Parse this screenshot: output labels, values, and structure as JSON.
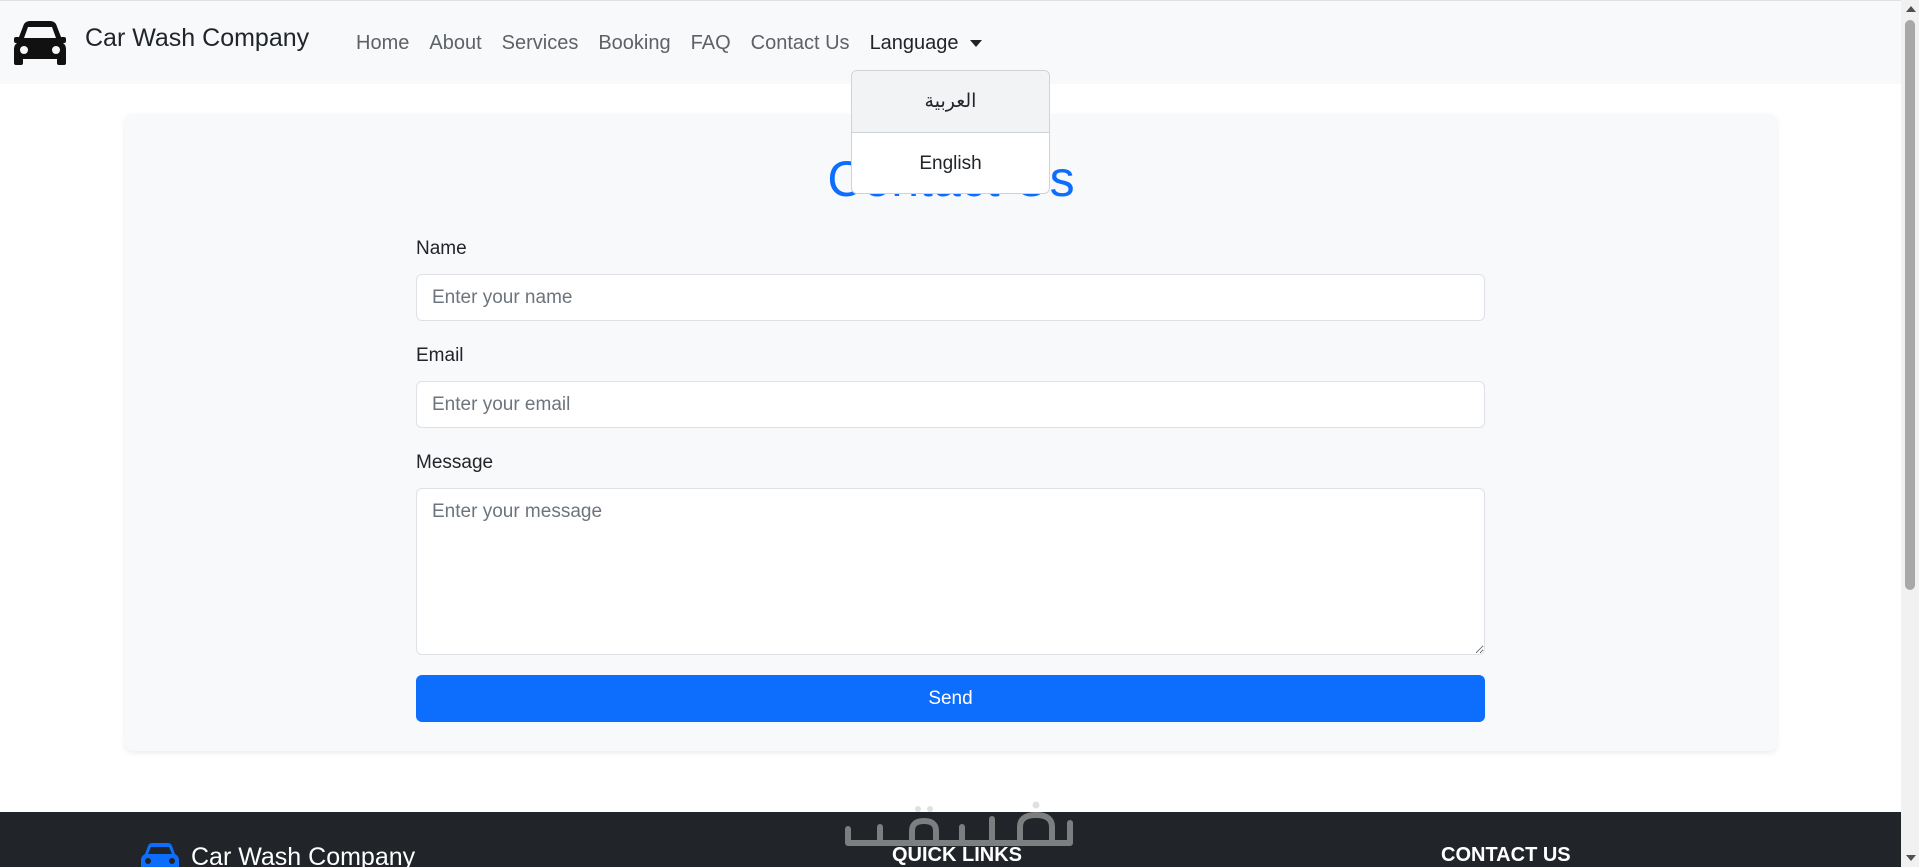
{
  "navbar": {
    "brand": "Car Wash Company",
    "brand_icon": "car-icon",
    "links": {
      "home": "Home",
      "about": "About",
      "services": "Services",
      "booking": "Booking",
      "faq": "FAQ",
      "contact": "Contact Us"
    },
    "language_label": "Language"
  },
  "language_dropdown": {
    "open": true,
    "options": [
      "العربية",
      "English"
    ],
    "highlighted": "العربية"
  },
  "contact_form": {
    "title": "Contact Us",
    "name_label": "Name",
    "name_placeholder": "Enter your name",
    "name_value": "",
    "email_label": "Email",
    "email_placeholder": "Enter your email",
    "email_value": "",
    "message_label": "Message",
    "message_placeholder": "Enter your message",
    "message_value": "",
    "send_label": "Send"
  },
  "footer": {
    "brand": "Car Wash Company",
    "quick_links_heading": "QUICK LINKS",
    "contact_heading": "CONTACT US",
    "brand_icon": "car-icon"
  },
  "watermark_text": "خمسات",
  "colors": {
    "accent": "#0d6efd",
    "navbar_bg": "#f8f9fa",
    "footer_bg": "#212529",
    "card_bg": "#f8f9fa"
  }
}
